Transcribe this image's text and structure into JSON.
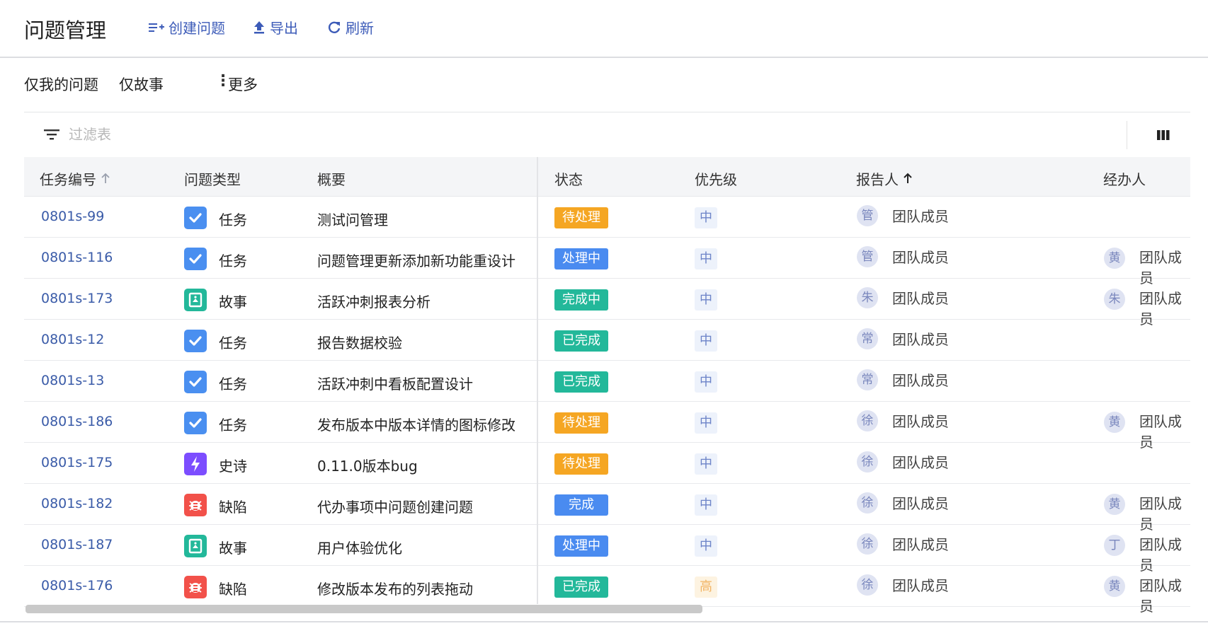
{
  "header": {
    "title": "问题管理",
    "create_label": "创建问题",
    "export_label": "导出",
    "refresh_label": "刷新"
  },
  "subnav": {
    "my_issues": "仅我的问题",
    "stories_only": "仅故事",
    "more": "更多"
  },
  "filter": {
    "placeholder": "过滤表"
  },
  "columns": {
    "task_id": "任务编号",
    "type": "问题类型",
    "summary": "概要",
    "status": "状态",
    "priority": "优先级",
    "reporter": "报告人",
    "assignee": "经办人"
  },
  "colors": {
    "status_pending": "#f5a623",
    "status_processing": "#4a8bf0",
    "status_completing": "#23b89a",
    "status_done_green": "#23b89a",
    "status_done_blue": "#4a8bf0",
    "task_icon": "#4a8ff0",
    "story_icon": "#23b89a",
    "epic_icon": "#7c4dff",
    "bug_icon": "#f2514a"
  },
  "rows": [
    {
      "id": "0801s-99",
      "type": "任务",
      "type_icon": "task",
      "summary": "测试问管理",
      "status": "待处理",
      "status_kind": "pending",
      "priority": "中",
      "reporter_avatar": "管",
      "reporter": "团队成员",
      "assignee_avatar": "",
      "assignee": ""
    },
    {
      "id": "0801s-116",
      "type": "任务",
      "type_icon": "task",
      "summary": "问题管理更新添加新功能重设计",
      "status": "处理中",
      "status_kind": "processing",
      "priority": "中",
      "reporter_avatar": "管",
      "reporter": "团队成员",
      "assignee_avatar": "黄",
      "assignee": "团队成员"
    },
    {
      "id": "0801s-173",
      "type": "故事",
      "type_icon": "story",
      "summary": "活跃冲刺报表分析",
      "status": "完成中",
      "status_kind": "completing",
      "priority": "中",
      "reporter_avatar": "朱",
      "reporter": "团队成员",
      "assignee_avatar": "朱",
      "assignee": "团队成员"
    },
    {
      "id": "0801s-12",
      "type": "任务",
      "type_icon": "task",
      "summary": "报告数据校验",
      "status": "已完成",
      "status_kind": "done_green",
      "priority": "中",
      "reporter_avatar": "常",
      "reporter": "团队成员",
      "assignee_avatar": "",
      "assignee": ""
    },
    {
      "id": "0801s-13",
      "type": "任务",
      "type_icon": "task",
      "summary": "活跃冲刺中看板配置设计",
      "status": "已完成",
      "status_kind": "done_green",
      "priority": "中",
      "reporter_avatar": "常",
      "reporter": "团队成员",
      "assignee_avatar": "",
      "assignee": ""
    },
    {
      "id": "0801s-186",
      "type": "任务",
      "type_icon": "task",
      "summary": "发布版本中版本详情的图标修改",
      "status": "待处理",
      "status_kind": "pending",
      "priority": "中",
      "reporter_avatar": "徐",
      "reporter": "团队成员",
      "assignee_avatar": "黄",
      "assignee": "团队成员"
    },
    {
      "id": "0801s-175",
      "type": "史诗",
      "type_icon": "epic",
      "summary": "0.11.0版本bug",
      "status": "待处理",
      "status_kind": "pending",
      "priority": "中",
      "reporter_avatar": "徐",
      "reporter": "团队成员",
      "assignee_avatar": "",
      "assignee": ""
    },
    {
      "id": "0801s-182",
      "type": "缺陷",
      "type_icon": "bug",
      "summary": "代办事项中问题创建问题",
      "status": "完成",
      "status_kind": "done_blue",
      "priority": "中",
      "reporter_avatar": "徐",
      "reporter": "团队成员",
      "assignee_avatar": "黄",
      "assignee": "团队成员"
    },
    {
      "id": "0801s-187",
      "type": "故事",
      "type_icon": "story",
      "summary": "用户体验优化",
      "status": "处理中",
      "status_kind": "processing",
      "priority": "中",
      "reporter_avatar": "徐",
      "reporter": "团队成员",
      "assignee_avatar": "丁",
      "assignee": "团队成员"
    },
    {
      "id": "0801s-176",
      "type": "缺陷",
      "type_icon": "bug",
      "summary": "修改版本发布的列表拖动",
      "status": "已完成",
      "status_kind": "done_green",
      "priority": "高",
      "reporter_avatar": "徐",
      "reporter": "团队成员",
      "assignee_avatar": "黄",
      "assignee": "团队成员"
    }
  ]
}
